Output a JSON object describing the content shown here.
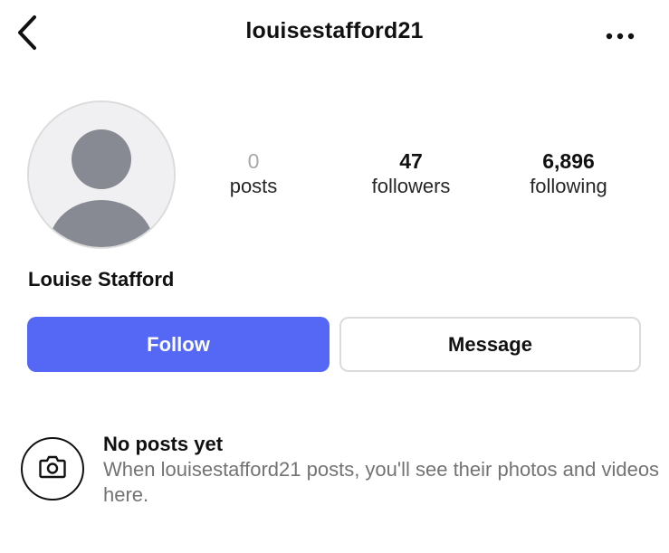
{
  "header": {
    "username": "louisestafford21",
    "back_icon": "chevron-left-icon",
    "more_icon": "more-horizontal-icon"
  },
  "profile": {
    "avatar_icon": "default-avatar-icon",
    "full_name": "Louise Stafford",
    "stats": {
      "posts": {
        "value": "0",
        "label": "posts"
      },
      "followers": {
        "value": "47",
        "label": "followers"
      },
      "following": {
        "value": "6,896",
        "label": "following"
      }
    }
  },
  "actions": {
    "follow_label": "Follow",
    "message_label": "Message"
  },
  "empty_state": {
    "icon": "camera-icon",
    "title": "No posts yet",
    "description": "When louisestafford21 posts, you'll see their photos and videos here."
  },
  "colors": {
    "follow_button": "#5468f5",
    "muted_text": "#737373",
    "posts_zero": "#a8a8a8"
  }
}
